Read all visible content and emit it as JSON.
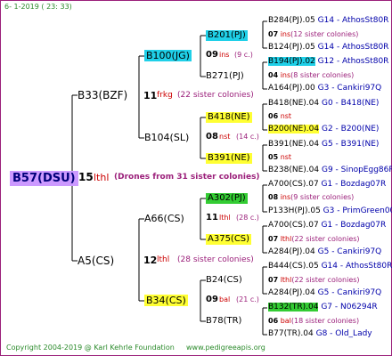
{
  "header": {
    "date": "6-  1-2019 ( 23: 33)"
  },
  "root": {
    "label": "B57(DSU)",
    "num": "15",
    "word": "lthl",
    "note": "(Drones from 31 sister colonies)"
  },
  "upper": {
    "label": "B33(BZF)",
    "num": "11",
    "word": "frkg",
    "note": "(22 sister colonies)",
    "a": {
      "label": "B100(JG)",
      "num": "09",
      "word": "ins",
      "note": "(9 c.)",
      "top": "B201(PJ)",
      "top_num": "07",
      "top_word": "ins",
      "top_note": "(12 sister colonies)",
      "bot": "B271(PJ)",
      "bot_num": "04",
      "bot_word": "ins",
      "bot_note": "(8 sister colonies)",
      "r1": "B284(PJ).05",
      "r1b": "G14 - AthosSt80R",
      "r2": "B124(PJ).05",
      "r2b": "G14 - AthosSt80R",
      "r3": "B194(PJ).02",
      "r3b": "G12 - AthosSt80R",
      "r4": "A164(PJ).00",
      "r4b": "G3 - Cankiri97Q"
    },
    "b": {
      "label": "B104(SL)",
      "num": "08",
      "word": "nst",
      "note": "(14 c.)",
      "top": "B418(NE)",
      "top_num": "06",
      "top_word": "nst",
      "bot": "B391(NE)",
      "bot_num": "05",
      "bot_word": "nst",
      "r1": "B418(NE).04",
      "r1b": "G0 - B418(NE)",
      "r2": "B200(NE).04",
      "r2b": "G2 - B200(NE)",
      "r3": "B391(NE).04",
      "r3b": "G5 - B391(NE)",
      "r4": "B238(NE).04",
      "r4b": "G9 - SinopEgg86R"
    }
  },
  "lower": {
    "label": "A5(CS)",
    "num": "12",
    "word": "lthl",
    "note": "(28 sister colonies)",
    "a": {
      "label": "A66(CS)",
      "num": "11",
      "word": "lthl",
      "note": "(28 c.)",
      "top": "A302(PJ)",
      "top_num": "08",
      "top_word": "ins",
      "top_note": "(9 sister colonies)",
      "bot": "A375(CS)",
      "bot_num": "07",
      "bot_word": "lthl",
      "bot_note": "(22 sister colonies)",
      "r1": "A700(CS).07",
      "r1b": "G1 - Bozdag07R",
      "r2": "P133H(PJ).05",
      "r2b": "G3 - PrimGreen00",
      "r3": "A700(CS).07",
      "r3b": "G1 - Bozdag07R",
      "r4": "A284(PJ).04",
      "r4b": "G5 - Cankiri97Q"
    },
    "b": {
      "label": "B34(CS)",
      "num": "09",
      "word": "bal",
      "note": "(21 c.)",
      "top": "B24(CS)",
      "top_num": "07",
      "top_word": "lthl",
      "top_note": "(22 sister colonies)",
      "bot": "B78(TR)",
      "bot_num": "06",
      "bot_word": "bal",
      "bot_note": "(18 sister colonies)",
      "r1": "B444(CS).05",
      "r1b": "G14 - AthosSt80R",
      "r2": "A284(PJ).04",
      "r2b": "G5 - Cankiri97Q",
      "r3": "B132(TR).04",
      "r3b": "G7 - N06294R",
      "r4": "B77(TR).04",
      "r4b": "G8 - Old_Lady"
    }
  },
  "footer": {
    "copyright": "Copyright 2004-2019 @ Karl Kehrle Foundation",
    "site": "www.pedigreeapis.org"
  },
  "colors": {
    "frame": "#9b1f7a",
    "blue_box": "#1fd0e8",
    "yellow_box": "#ffff33",
    "green_box": "#33cc33",
    "root_box": "#cc99ff"
  }
}
